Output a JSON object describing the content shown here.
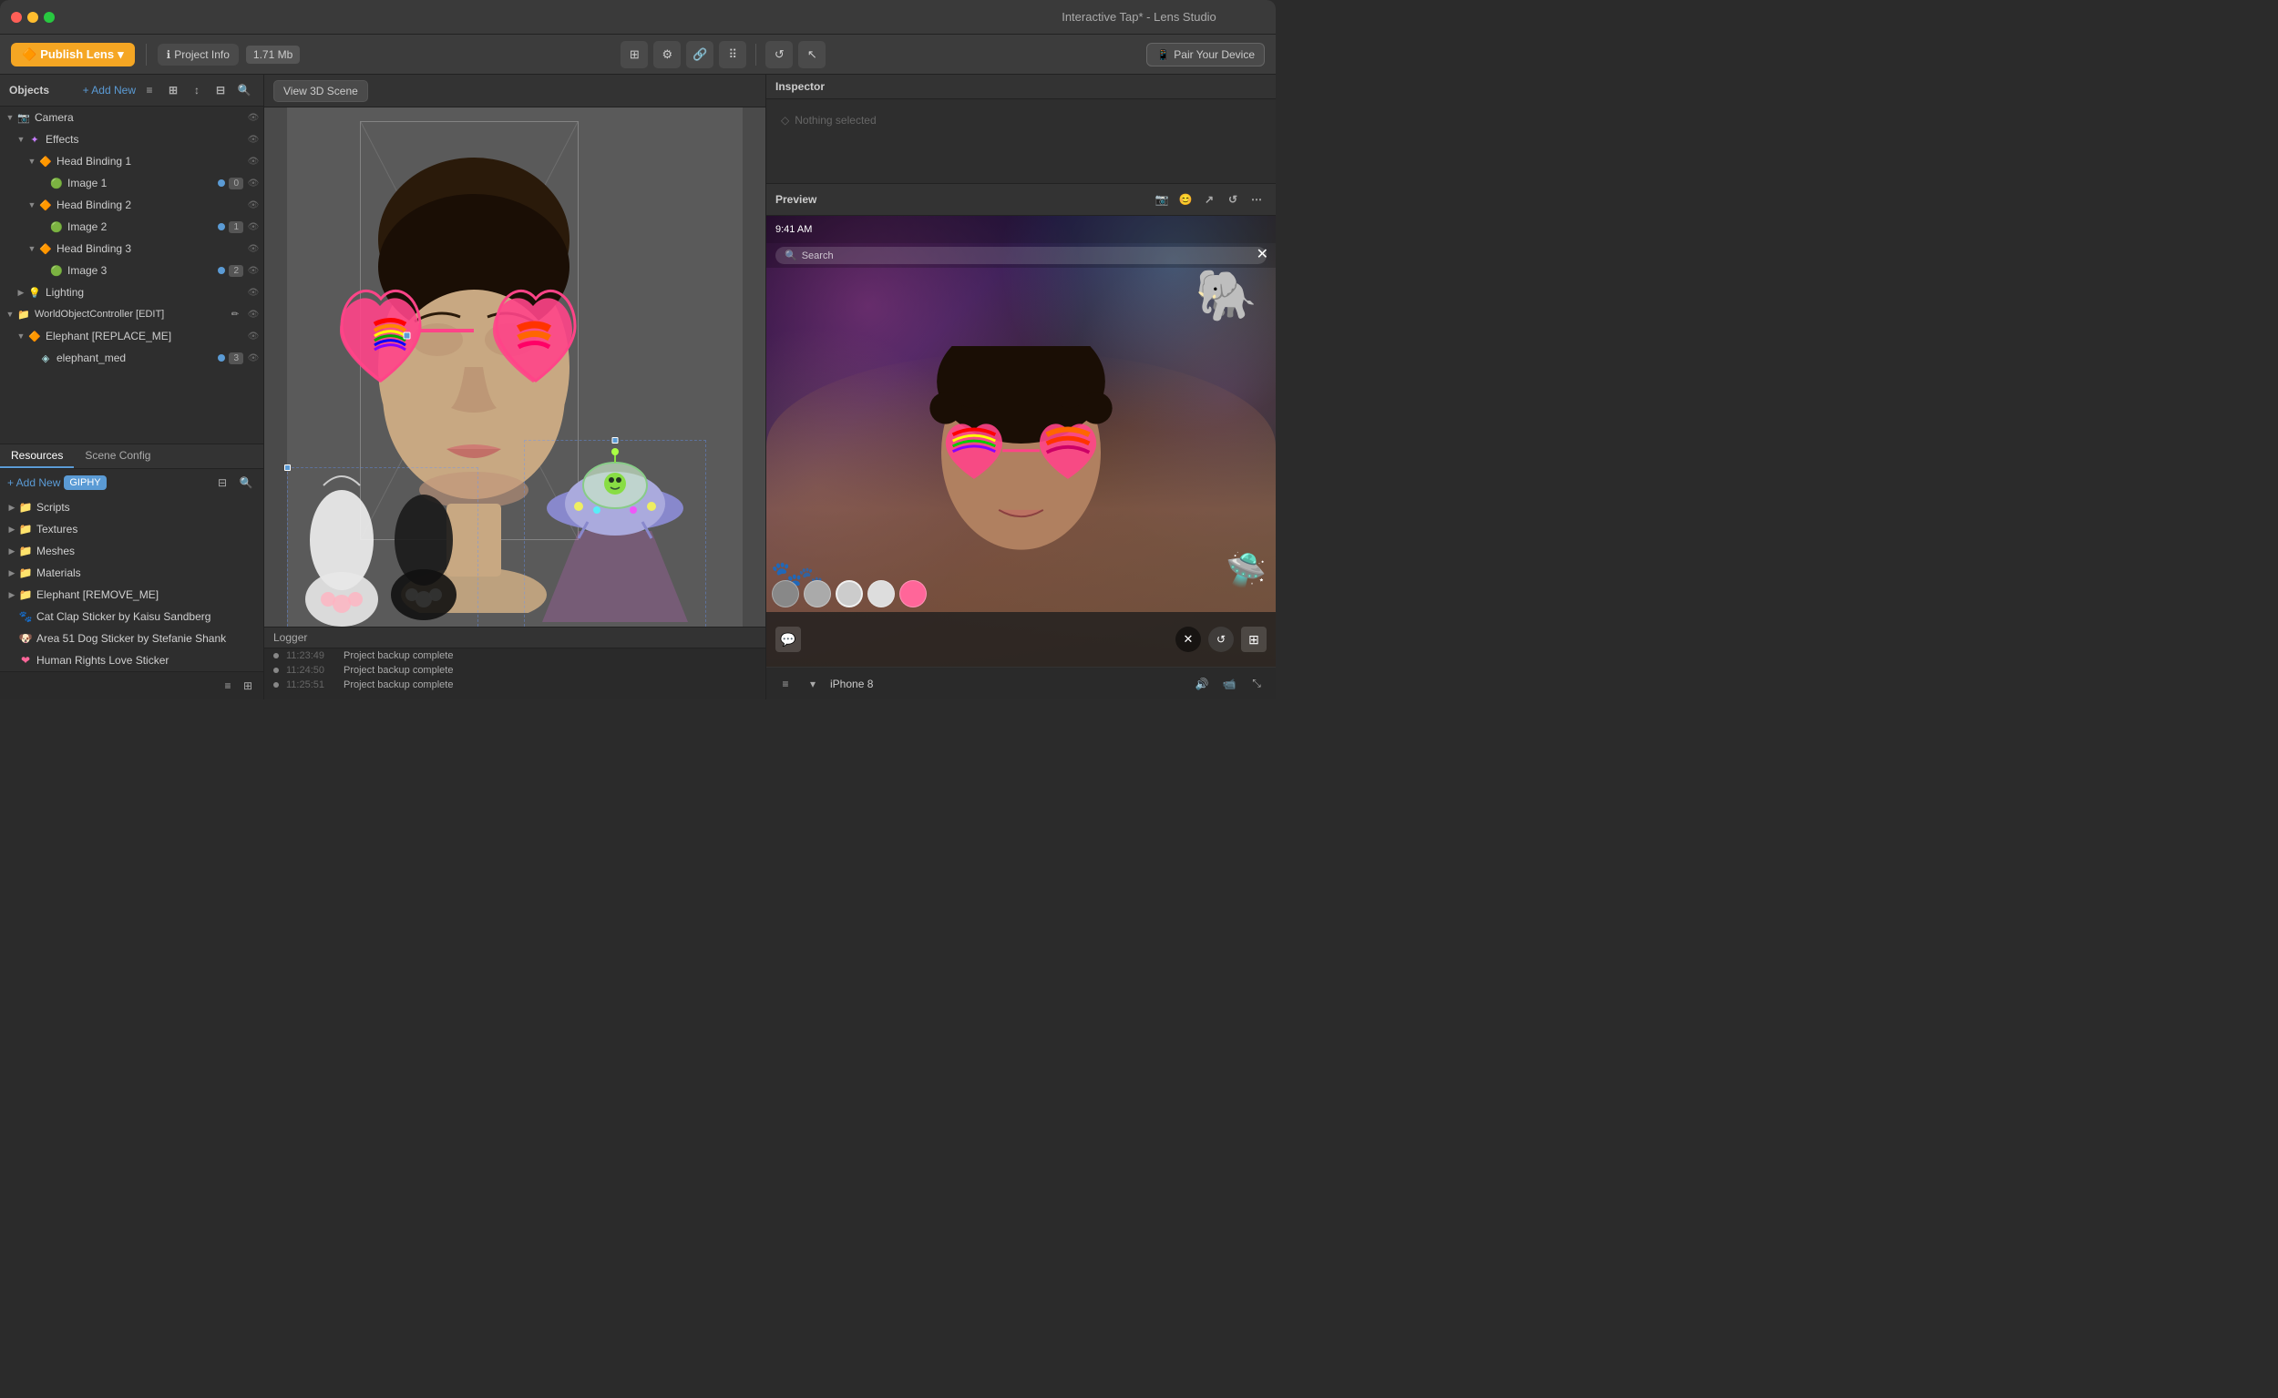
{
  "window": {
    "title": "Interactive Tap* - Lens Studio"
  },
  "traffic_lights": {
    "red": "#ff5f57",
    "yellow": "#ffbd2e",
    "green": "#28c840"
  },
  "title_bar": {
    "title": "Interactive Tap* - Lens Studio"
  },
  "top_toolbar": {
    "publish_label": "Publish Lens",
    "project_info_label": "Project Info",
    "file_size": "1.71 Mb",
    "pair_device_label": "Pair Your Device"
  },
  "objects_panel": {
    "title": "Objects",
    "add_new_label": "+ Add New",
    "tree": [
      {
        "id": "camera",
        "level": 0,
        "label": "Camera",
        "icon": "camera",
        "has_arrow": true,
        "expanded": true
      },
      {
        "id": "effects",
        "level": 1,
        "label": "Effects",
        "icon": "effects",
        "has_arrow": true,
        "expanded": true
      },
      {
        "id": "head-binding-1",
        "level": 2,
        "label": "Head Binding 1",
        "icon": "head",
        "has_arrow": true,
        "expanded": true
      },
      {
        "id": "image-1",
        "level": 3,
        "label": "Image 1",
        "icon": "image",
        "has_arrow": false,
        "badge": "0",
        "dot_color": "blue"
      },
      {
        "id": "head-binding-2",
        "level": 2,
        "label": "Head Binding 2",
        "icon": "head",
        "has_arrow": true,
        "expanded": true
      },
      {
        "id": "image-2",
        "level": 3,
        "label": "Image 2",
        "icon": "image",
        "has_arrow": false,
        "badge": "1",
        "dot_color": "blue"
      },
      {
        "id": "head-binding-3",
        "level": 2,
        "label": "Head Binding 3",
        "icon": "head",
        "has_arrow": true,
        "expanded": true
      },
      {
        "id": "image-3",
        "level": 3,
        "label": "Image 3",
        "icon": "image",
        "has_arrow": false,
        "badge": "2",
        "dot_color": "blue"
      },
      {
        "id": "lighting",
        "level": 1,
        "label": "Lighting",
        "icon": "lighting",
        "has_arrow": true,
        "expanded": false
      },
      {
        "id": "world-controller",
        "level": 0,
        "label": "WorldObjectController [EDIT]",
        "icon": "world",
        "has_arrow": true,
        "expanded": true
      },
      {
        "id": "elephant-replace",
        "level": 1,
        "label": "Elephant [REPLACE_ME]",
        "icon": "elephant",
        "has_arrow": true,
        "expanded": true
      },
      {
        "id": "elephant-med",
        "level": 2,
        "label": "elephant_med",
        "icon": "mesh",
        "has_arrow": false,
        "badge": "3",
        "dot_color": "blue"
      }
    ]
  },
  "resources_panel": {
    "tabs": [
      "Resources",
      "Scene Config"
    ],
    "active_tab": "Resources",
    "add_new_label": "+ Add New",
    "giphy_label": "GIPHY",
    "folders": [
      {
        "id": "scripts",
        "label": "Scripts",
        "color": "blue"
      },
      {
        "id": "textures",
        "label": "Textures",
        "color": "blue"
      },
      {
        "id": "meshes",
        "label": "Meshes",
        "color": "blue"
      },
      {
        "id": "materials",
        "label": "Materials",
        "color": "blue"
      },
      {
        "id": "elephant-remove",
        "label": "Elephant [REMOVE_ME]",
        "color": "orange"
      }
    ],
    "stickers": [
      {
        "id": "cat-clap",
        "label": "Cat Clap Sticker by Kaisu Sandberg"
      },
      {
        "id": "area51",
        "label": "Area 51 Dog Sticker by Stefanie Shank"
      },
      {
        "id": "human-rights",
        "label": "Human Rights Love Sticker"
      }
    ]
  },
  "viewport": {
    "view3d_label": "View 3D Scene"
  },
  "logger": {
    "title": "Logger",
    "entries": [
      {
        "time": "11:23:49",
        "message": "Project backup complete"
      },
      {
        "time": "11:24:50",
        "message": "Project backup complete"
      },
      {
        "time": "11:25:51",
        "message": "Project backup complete"
      }
    ]
  },
  "inspector": {
    "title": "Inspector",
    "nothing_selected": "Nothing selected"
  },
  "preview": {
    "title": "Preview",
    "time": "9:41 AM",
    "search_placeholder": "Search",
    "device_label": "iPhone 8"
  },
  "filter_circles": [
    {
      "color": "#888"
    },
    {
      "color": "#aaa"
    },
    {
      "color": "#bbb"
    },
    {
      "color": "#fff"
    },
    {
      "color": "#ff6699"
    }
  ]
}
